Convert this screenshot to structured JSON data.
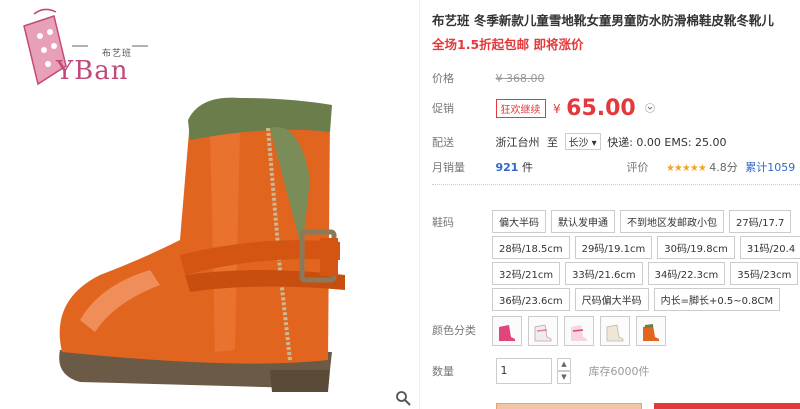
{
  "brand": {
    "name_cn": "布艺班",
    "logo_text": "YBan"
  },
  "product": {
    "title": "布艺班 冬季新款儿童雪地靴女童男童防水防滑棉鞋皮靴冬靴儿",
    "promo": "全场1.5折起包邮 即将涨价"
  },
  "price": {
    "label": "价格",
    "yen": "¥",
    "original": "368.00"
  },
  "promotion": {
    "label": "促销",
    "tag": "狂欢继续",
    "yen": "¥",
    "price": "65.00"
  },
  "shipping": {
    "label": "配送",
    "from": "浙江台州",
    "to_word": "至",
    "to": "长沙",
    "express": "快递: 0.00 EMS: 25.00"
  },
  "sales": {
    "label": "月销量",
    "count": "921",
    "unit": "件",
    "review_label": "评价",
    "stars": "★★★★★",
    "rating": "4.8分",
    "total": "累计1059"
  },
  "sizes": {
    "label": "鞋码",
    "rows": [
      [
        "偏大半码",
        "默认发申通",
        "不到地区发邮政小包",
        "27码/17.7"
      ],
      [
        "28码/18.5cm",
        "29码/19.1cm",
        "30码/19.8cm",
        "31码/20.4"
      ],
      [
        "32码/21cm",
        "33码/21.6cm",
        "34码/22.3cm",
        "35码/23cm"
      ],
      [
        "36码/23.6cm",
        "尺码偏大半码",
        "内长=脚长+0.5~0.8CM"
      ]
    ]
  },
  "colors": {
    "label": "颜色分类",
    "swatches": [
      "pink",
      "white",
      "pink-white",
      "beige",
      "orange"
    ]
  },
  "quantity": {
    "label": "数量",
    "value": "1",
    "stock": "库存6000件"
  }
}
